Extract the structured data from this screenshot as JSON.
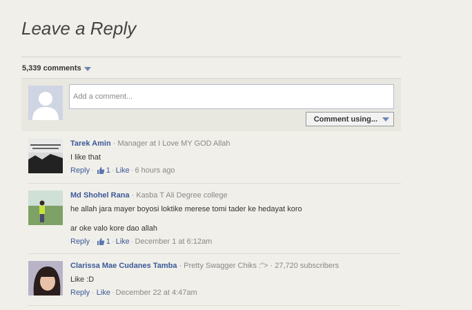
{
  "section_title": "Leave a Reply",
  "comment_count": "5,339 comments",
  "compose": {
    "placeholder": "Add a comment...",
    "submit_label": "Comment using..."
  },
  "actions": {
    "reply": "Reply",
    "like": "Like"
  },
  "comments": [
    {
      "name": "Tarek Amin",
      "subtitle": " · Manager at I Love MY GOD Allah",
      "lines": [
        "I like that"
      ],
      "likes": "1",
      "time": "6 hours ago"
    },
    {
      "name": "Md Shohel Rana",
      "subtitle": " · Kasba T Ali Degree college",
      "lines": [
        "he allah jara mayer boyosi loktike merese tomi tader ke hedayat koro",
        "ar oke valo kore dao allah"
      ],
      "likes": "1",
      "time": "December 1 at 6:12am"
    },
    {
      "name": "Clarissa Mae Cudanes Tamba",
      "subtitle": " · Pretty Swagger Chiks :\"> · 27,720 subscribers",
      "lines": [
        "Like :D"
      ],
      "likes": "",
      "time": "December 22 at 4:47am"
    }
  ],
  "colors": {
    "link": "#3b5998",
    "background": "#f0efe9"
  }
}
